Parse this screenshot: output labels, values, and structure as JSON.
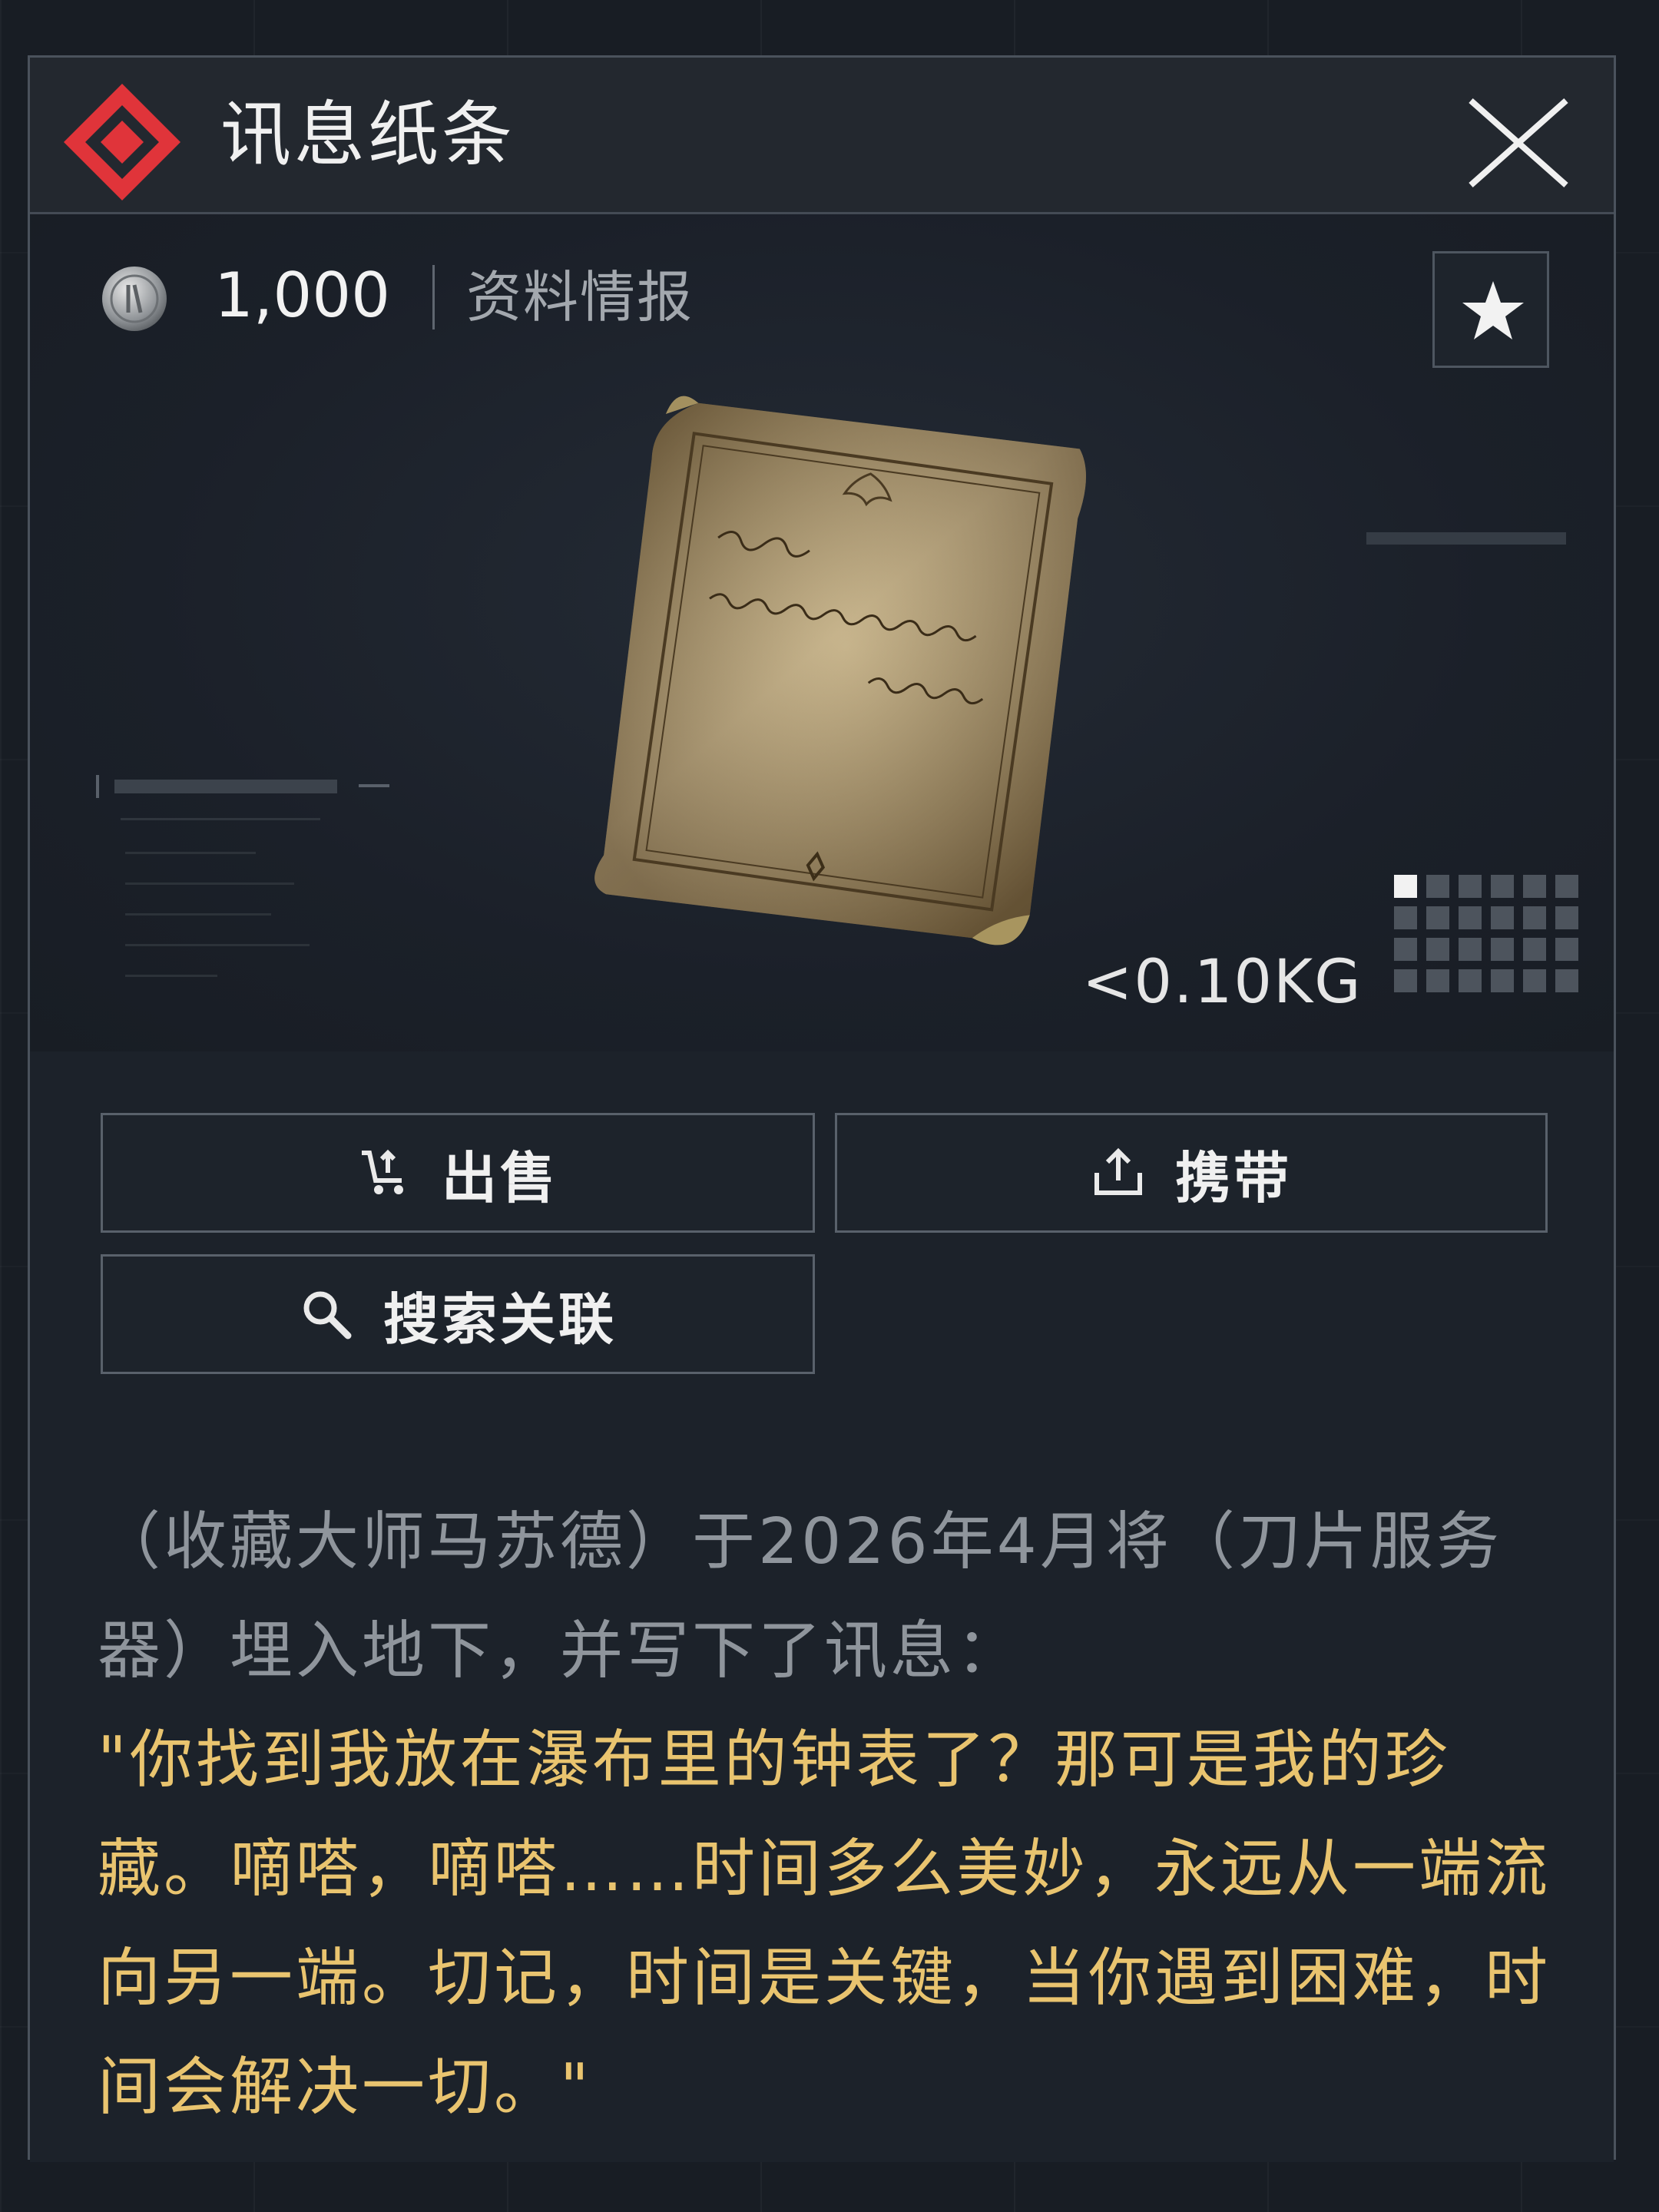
{
  "window": {
    "title": "讯息纸条"
  },
  "item": {
    "price": "1,000",
    "category": "资料情报",
    "weight": "<0.10KG",
    "icon": "message-note-paper",
    "coin_icon": "silver-coin-icon"
  },
  "actions": {
    "sell_label": "出售",
    "carry_label": "携带",
    "search_label": "搜索关联"
  },
  "description": {
    "intro": "（收藏大师马苏德）于2026年4月将（刀片服务器）埋入地下，并写下了讯息：",
    "quote": "\"你找到我放在瀑布里的钟表了？那可是我的珍藏。嘀嗒，嘀嗒……时间多么美妙，永远从一端流向另一端。切记，时间是关键，当你遇到困难，时间会解决一切。\""
  },
  "colors": {
    "accent": "#e0343a",
    "quote": "#e9c46f",
    "text_muted": "#8f959c"
  }
}
